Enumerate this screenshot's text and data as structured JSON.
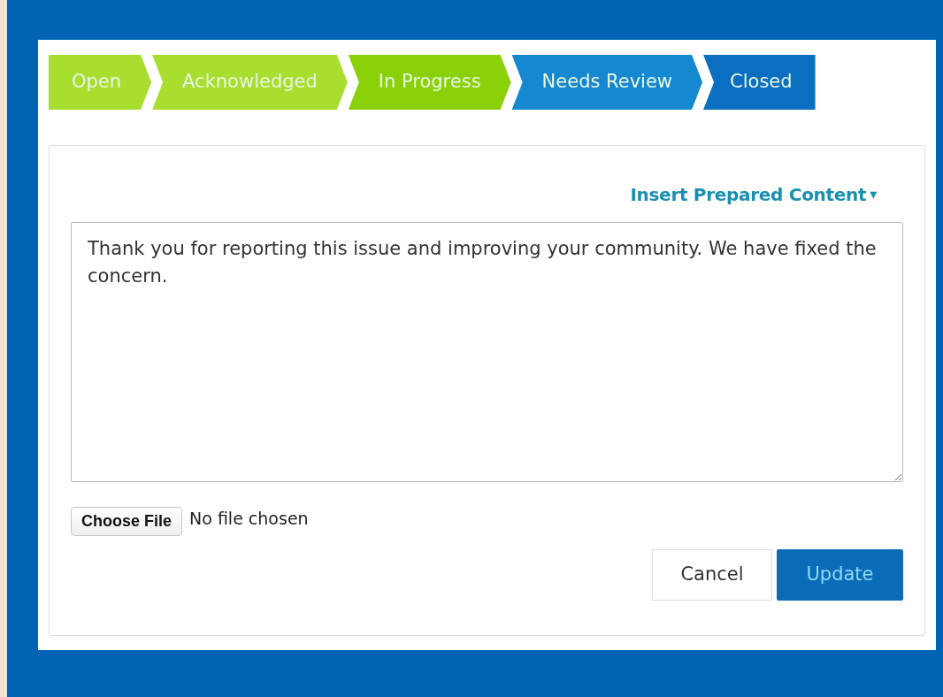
{
  "steps": [
    {
      "label": "Open",
      "color": "#a8de2e"
    },
    {
      "label": "Acknowledged",
      "color": "#a8de2e"
    },
    {
      "label": "In Progress",
      "color": "#8ad10a"
    },
    {
      "label": "Needs Review",
      "color": "#1688d2"
    },
    {
      "label": "Closed",
      "color": "#0a6fc0"
    }
  ],
  "insert_link": {
    "label": "Insert Prepared Content",
    "caret": "▾"
  },
  "response": {
    "value": "Thank you for reporting this issue and improving your community. We have fixed the concern."
  },
  "file_picker": {
    "button": "Choose File",
    "status": "No file chosen"
  },
  "buttons": {
    "cancel": "Cancel",
    "update": "Update"
  }
}
